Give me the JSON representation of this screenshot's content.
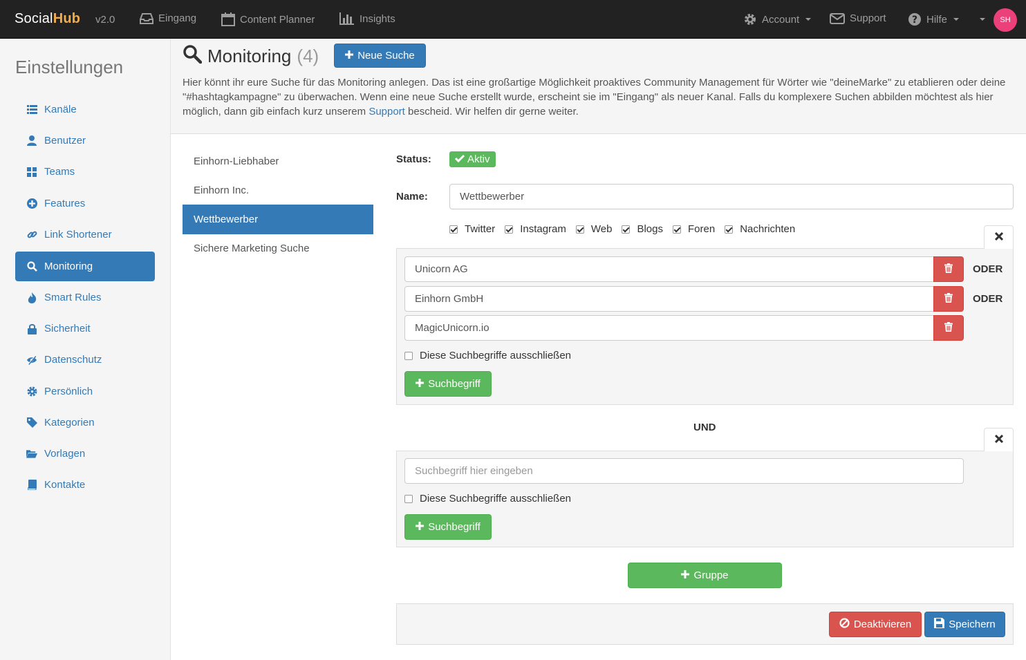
{
  "navbar": {
    "brand_social": "Social",
    "brand_hub": "Hub",
    "version": "v2.0",
    "items": [
      {
        "label": "Eingang",
        "icon": "inbox-icon"
      },
      {
        "label": "Content Planner",
        "icon": "calendar-icon"
      },
      {
        "label": "Insights",
        "icon": "bar-chart-icon"
      }
    ],
    "account": "Account",
    "support": "Support",
    "hilfe": "Hilfe",
    "avatar": "SH"
  },
  "sidebar": {
    "title": "Einstellungen",
    "items": [
      {
        "label": "Kanäle",
        "icon": "list-icon"
      },
      {
        "label": "Benutzer",
        "icon": "user-icon"
      },
      {
        "label": "Teams",
        "icon": "grid-icon"
      },
      {
        "label": "Features",
        "icon": "plus-circle-icon"
      },
      {
        "label": "Link Shortener",
        "icon": "link-icon"
      },
      {
        "label": "Monitoring",
        "icon": "search-icon"
      },
      {
        "label": "Smart Rules",
        "icon": "fire-icon"
      },
      {
        "label": "Sicherheit",
        "icon": "lock-icon"
      },
      {
        "label": "Datenschutz",
        "icon": "eye-slash-icon"
      },
      {
        "label": "Persönlich",
        "icon": "cog-icon"
      },
      {
        "label": "Kategorien",
        "icon": "tag-icon"
      },
      {
        "label": "Vorlagen",
        "icon": "folder-open-icon"
      },
      {
        "label": "Kontakte",
        "icon": "book-icon"
      }
    ],
    "active_index": 5
  },
  "header": {
    "title": "Monitoring",
    "count": "(4)",
    "new_search_label": "Neue Suche",
    "intro_part1": "Hier könnt ihr eure Suche für das Monitoring anlegen. Das ist eine großartige Möglichkeit proaktives Community Management für Wörter wie \"deineMarke\" zu etablieren oder deine \"#hashtagkampagne\" zu überwachen. Wenn eine neue Suche erstellt wurde, erscheint sie im \"Eingang\" als neuer Kanal. Falls du komplexere Suchen abbilden möchtest als hier möglich, dann gib einfach kurz unserem ",
    "intro_link": "Support",
    "intro_part2": " bescheid. Wir helfen dir gerne weiter."
  },
  "searches": [
    "Einhorn-Liebhaber",
    "Einhorn Inc.",
    "Wettbewerber",
    "Sichere Marketing Suche"
  ],
  "active_search": 2,
  "form": {
    "status_label": "Status:",
    "status_value": "Aktiv",
    "name_label": "Name:",
    "name_value": "Wettbewerber",
    "channels": [
      {
        "label": "Twitter",
        "checked": true
      },
      {
        "label": "Instagram",
        "checked": true
      },
      {
        "label": "Web",
        "checked": true
      },
      {
        "label": "Blogs",
        "checked": true
      },
      {
        "label": "Foren",
        "checked": true
      },
      {
        "label": "Nachrichten",
        "checked": true
      }
    ],
    "group1": {
      "terms": [
        "Unicorn AG",
        "Einhorn GmbH",
        "MagicUnicorn.io"
      ],
      "or_label": "ODER",
      "exclude_label": "Diese Suchbegriffe ausschließen",
      "add_term_label": "Suchbegriff"
    },
    "and_label": "UND",
    "group2": {
      "placeholder": "Suchbegriff hier eingeben",
      "exclude_label": "Diese Suchbegriffe ausschließen",
      "add_term_label": "Suchbegriff"
    },
    "add_group_label": "Gruppe",
    "deactivate_label": "Deaktivieren",
    "save_label": "Speichern"
  },
  "colors": {
    "primary": "#337ab7",
    "success": "#5cb85c",
    "danger": "#d9534f",
    "navbar": "#222222",
    "brand_accent": "#f0ad4e",
    "avatar": "#ec407a"
  }
}
